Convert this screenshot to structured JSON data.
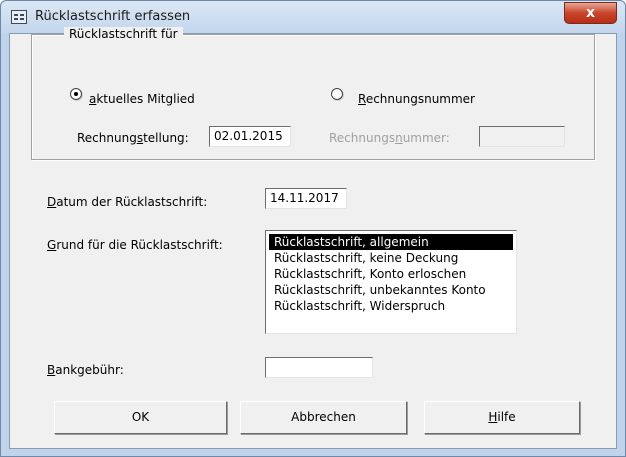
{
  "window": {
    "title": "Rücklastschrift erfassen",
    "close_symbol": "x",
    "icon": "form-icon"
  },
  "group": {
    "legend": "Rücklastschrift für",
    "radio_member": {
      "prefix": "",
      "access_key": "a",
      "rest": "ktuelles Mitglied",
      "checked": true
    },
    "radio_invoice": {
      "prefix": "",
      "access_key": "R",
      "rest": "echnungsnummer",
      "checked": false
    },
    "billing_label": {
      "prefix": "Rechnung",
      "access_key": "s",
      "rest": "tellung:"
    },
    "billing_value": "02.01.2015",
    "invoice_label": {
      "prefix": "Rechnungs",
      "access_key": "n",
      "rest": "ummer:"
    },
    "invoice_value": ""
  },
  "date": {
    "label": {
      "prefix": "",
      "access_key": "D",
      "rest": "atum der Rücklastschrift:"
    },
    "value": "14.11.2017"
  },
  "reason": {
    "label": {
      "prefix": "",
      "access_key": "G",
      "rest": "rund für die Rücklastschrift:"
    },
    "items": [
      "Rücklastschrift, allgemein",
      "Rücklastschrift, keine Deckung",
      "Rücklastschrift, Konto erloschen",
      "Rücklastschrift, unbekanntes Konto",
      "Rücklastschrift, Widerspruch"
    ],
    "selected_index": 0
  },
  "fee": {
    "label": {
      "prefix": "",
      "access_key": "B",
      "rest": "ankgebühr:"
    },
    "value": ""
  },
  "buttons": {
    "ok": "OK",
    "cancel": "Abbrechen",
    "help": {
      "prefix": "",
      "access_key": "H",
      "rest": "ilfe"
    }
  }
}
